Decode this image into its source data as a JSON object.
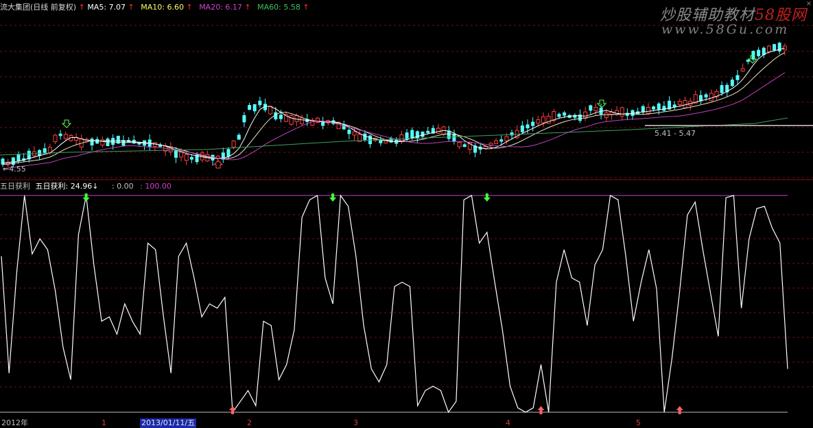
{
  "header": {
    "stock": "流大集团(日线 前复权)",
    "ma5": "MA5: 7.07",
    "ma10": "MA10: 6.60",
    "ma20": "MA20: 6.17",
    "ma60": "MA60: 5.58",
    "colors": {
      "stock": "#d8d8d8",
      "ma5": "#ffffff",
      "ma10": "#ffff00",
      "ma20": "#d040d0",
      "ma60": "#40c060",
      "arrow": "#ff3030"
    }
  },
  "watermark": {
    "line1_prefix": "炒股辅助教材",
    "line1_brand": "58股网",
    "line2": "www.58Gu.com"
  },
  "price_panel": {
    "low_label": "4.55",
    "range_label": "5.41 - 5.47",
    "colors": {
      "up": "#ff4040",
      "down": "#54ffff",
      "ma5": "#ffffff",
      "ma10": "#e8e8c8",
      "ma20": "#c040c0",
      "ma60": "#40a060",
      "grid": "#7a1010"
    }
  },
  "indicator": {
    "name": "五日获利",
    "value_label": "五日获利: 24.96",
    "arrow": "↓",
    "min_label": ": 0.00",
    "max_label": ": 100.00",
    "colors": {
      "name": "#c0c0c0",
      "value": "#ffffff",
      "min": "#c0c0c0",
      "max": "#d040d0",
      "line": "#ffffff",
      "top": "#d040d0",
      "bottom": "#c0c0c0"
    }
  },
  "xaxis": {
    "labels": [
      "2012年",
      "1",
      "2013/01/11/五",
      "2",
      "3",
      "4",
      "5"
    ],
    "cursor_label": "2013/01/11/五"
  },
  "chart_data": {
    "type": "line",
    "title": "五日获利",
    "ylim": [
      0,
      100
    ],
    "values": [
      72,
      18,
      65,
      100,
      73,
      80,
      75,
      56,
      30,
      15,
      82,
      100,
      68,
      42,
      44,
      36,
      50,
      42,
      36,
      78,
      75,
      45,
      18,
      72,
      78,
      62,
      44,
      50,
      48,
      53,
      0,
      5,
      10,
      3,
      42,
      40,
      15,
      22,
      38,
      90,
      98,
      100,
      62,
      50,
      100,
      95,
      72,
      40,
      20,
      14,
      22,
      58,
      60,
      58,
      3,
      10,
      12,
      10,
      0,
      5,
      98,
      100,
      78,
      83,
      60,
      38,
      12,
      2,
      0,
      2,
      22,
      0,
      60,
      75,
      62,
      60,
      40,
      68,
      75,
      100,
      98,
      72,
      42,
      60,
      75,
      57,
      0,
      25,
      56,
      91,
      97,
      75,
      55,
      35,
      99,
      100,
      48,
      80,
      94,
      95,
      85,
      78,
      20
    ],
    "buy_arrow_index": [
      30,
      70,
      88
    ],
    "sell_arrow_index": [
      11,
      43,
      63
    ]
  }
}
